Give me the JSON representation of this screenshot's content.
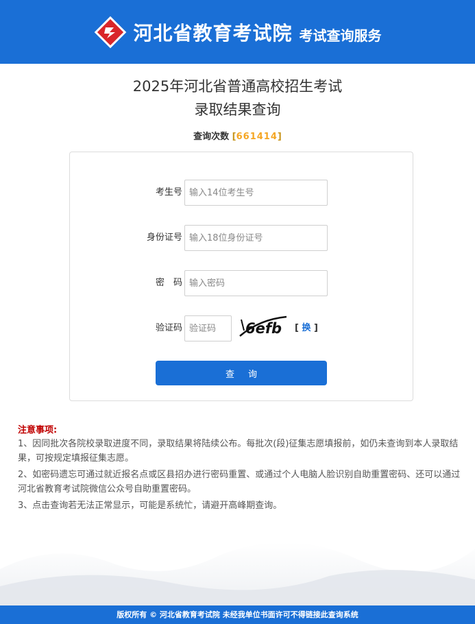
{
  "header": {
    "org_name": "河北省教育考试院",
    "service_name": "考试查询服务"
  },
  "page": {
    "title_line1": "2025年河北省普通高校招生考试",
    "title_line2": "录取结果查询",
    "query_count_label": "查询次数",
    "query_count_value": "661414"
  },
  "form": {
    "exam_id": {
      "label": "考生号",
      "placeholder": "输入14位考生号",
      "value": ""
    },
    "id_card": {
      "label": "身份证号",
      "placeholder": "输入18位身份证号",
      "value": ""
    },
    "password": {
      "label": "密　码",
      "placeholder": "输入密码",
      "value": ""
    },
    "captcha": {
      "label": "验证码",
      "placeholder": "验证码",
      "value": "",
      "image_text": "6efb"
    },
    "refresh_label": "换",
    "submit_label": "查询"
  },
  "notice": {
    "title": "注意事项:",
    "items": [
      "1、因同批次各院校录取进度不同，录取结果将陆续公布。每批次(段)征集志愿填报前，如仍未查询到本人录取结果，可按规定填报征集志愿。",
      "2、如密码遗忘可通过就近报名点或区县招办进行密码重置、或通过个人电脑人脸识别自助重置密码、还可以通过河北省教育考试院微信公众号自助重置密码。",
      "3、点击查询若无法正常显示，可能是系统忙，请避开高峰期查询。"
    ]
  },
  "footer": {
    "text": "版权所有 © 河北省教育考试院 未经我单位书面许可不得链接此查询系统"
  },
  "colors": {
    "primary": "#1a6fd6",
    "logo_red": "#d9262a",
    "notice_title": "#c00000",
    "count_value": "#f5a623"
  }
}
